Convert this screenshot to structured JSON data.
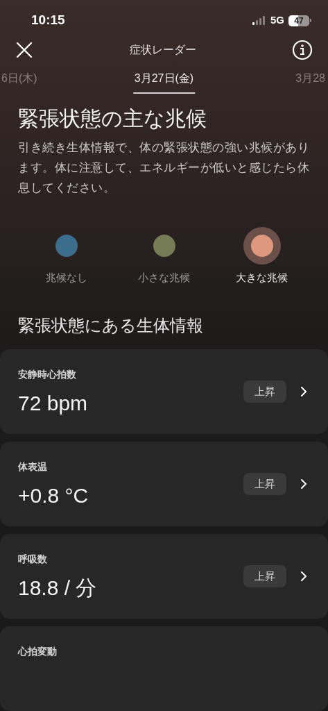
{
  "status_bar": {
    "time": "10:15",
    "network": "5G",
    "battery": "47"
  },
  "nav": {
    "title": "症状レーダー"
  },
  "date_tabs": [
    {
      "label": "6日(木)",
      "selected": false
    },
    {
      "label": "3月27日(金)",
      "selected": true
    },
    {
      "label": "3月28",
      "selected": false
    }
  ],
  "heading": "緊張状態の主な兆候",
  "description": "引き続き生体情報で、体の緊張状態の強い兆候があります。体に注意して、エネルギーが低いと感じたら休息してください。",
  "legend": [
    {
      "label": "兆候なし",
      "color": "#3d6d8c",
      "selected": false
    },
    {
      "label": "小さな兆候",
      "color": "#767c56",
      "selected": false
    },
    {
      "label": "大きな兆候",
      "color": "#df977e",
      "selected": true
    }
  ],
  "section_title": "緊張状態にある生体情報",
  "metrics": [
    {
      "name": "安静時心拍数",
      "value": "72 bpm",
      "badge": "上昇"
    },
    {
      "name": "体表温",
      "value": "+0.8 °C",
      "badge": "上昇"
    },
    {
      "name": "呼吸数",
      "value": "18.8 / 分",
      "badge": "上昇"
    },
    {
      "name": "心拍変動"
    }
  ]
}
